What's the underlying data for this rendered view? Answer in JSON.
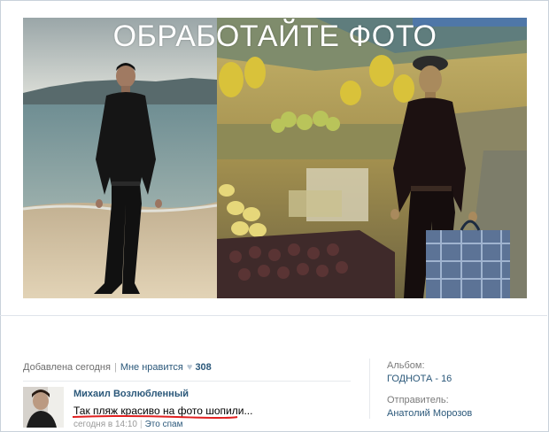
{
  "photo": {
    "caption": "ОБРАБОТАЙТЕ ФОТО"
  },
  "meta": {
    "added": "Добавлена сегодня",
    "like_label": "Мне нравится",
    "like_count": "308"
  },
  "comment": {
    "author": "Михаил Возлюбленный",
    "text": "Так пляж красиво на фото шопили...",
    "time": "сегодня в 14:10",
    "spam_label": "Это спам"
  },
  "sidebar": {
    "album_label": "Альбом:",
    "album_name": "ГОДНОТА - 16",
    "sender_label": "Отправитель:",
    "sender_name": "Анатолий Морозов"
  },
  "colors": {
    "link": "#2b587a",
    "underline": "#e02020",
    "border": "#c9d1da"
  }
}
